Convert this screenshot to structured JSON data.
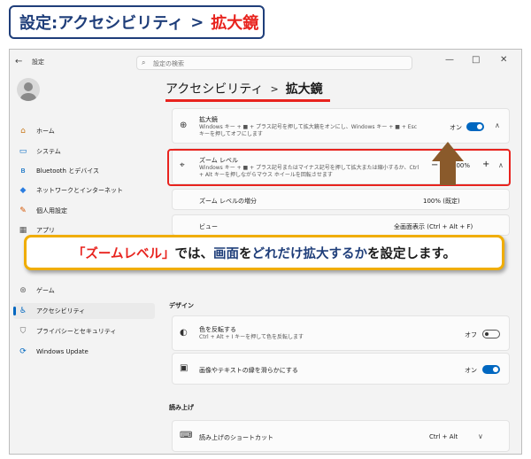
{
  "header": {
    "title_part1": "設定:アクセシビリティ",
    "title_sep": ">",
    "title_part2": "拡大鏡"
  },
  "window": {
    "app_title": "設定",
    "search_placeholder": "設定の検索",
    "controls": {
      "minimize": "—",
      "maximize": "□",
      "close": "✕"
    }
  },
  "sidebar": {
    "items": [
      {
        "label": "ホーム",
        "icon": "home-icon",
        "glyph": "⌂",
        "color": "#c97a1e"
      },
      {
        "label": "システム",
        "icon": "monitor-icon",
        "glyph": "▭",
        "color": "#0067c0"
      },
      {
        "label": "Bluetooth とデバイス",
        "icon": "bluetooth-icon",
        "glyph": "ʙ",
        "color": "#0067c0"
      },
      {
        "label": "ネットワークとインターネット",
        "icon": "wifi-icon",
        "glyph": "◆",
        "color": "#2b7de0"
      },
      {
        "label": "個人用設定",
        "icon": "brush-icon",
        "glyph": "✎",
        "color": "#d45500"
      },
      {
        "label": "アプリ",
        "icon": "apps-icon",
        "glyph": "▦",
        "color": "#555555"
      },
      {
        "label": "ゲーム",
        "icon": "gamepad-icon",
        "glyph": "⊛",
        "color": "#666666"
      },
      {
        "label": "アクセシビリティ",
        "icon": "accessibility-icon",
        "glyph": "♿",
        "color": "#0067c0"
      },
      {
        "label": "プライバシーとセキュリティ",
        "icon": "shield-icon",
        "glyph": "⛉",
        "color": "#666666"
      },
      {
        "label": "Windows Update",
        "icon": "update-icon",
        "glyph": "⟳",
        "color": "#0067c0"
      }
    ]
  },
  "breadcrumb": {
    "parent": "アクセシビリティ",
    "sep": ">",
    "current": "拡大鏡"
  },
  "magnifier": {
    "title": "拡大鏡",
    "desc": "Windows キー + ■ + プラス記号を押して拡大鏡をオンにし、Windows キー + ■ + Esc キーを押してオフにします",
    "state": "オン"
  },
  "zoom_level": {
    "title": "ズーム レベル",
    "desc": "Windows キー + ■ + プラス記号またはマイナス記号を押して拡大または縮小するか、Ctrl + Alt キーを押しながらマウス ホイールを回転させます",
    "minus": "−",
    "value": "100%",
    "plus": "+"
  },
  "zoom_increment": {
    "title": "ズーム レベルの増分",
    "value": "100% (既定)"
  },
  "view": {
    "title": "ビュー",
    "value": "全画面表示 (Ctrl + Alt + F)"
  },
  "callout": {
    "part1": "「ズームレベル」",
    "part2": "では、",
    "part3": "画面",
    "part4": "を",
    "part5": "どれだけ拡大するか",
    "part6": "を設定します。"
  },
  "design_section": {
    "label": "デザイン"
  },
  "invert_colors": {
    "title": "色を反転する",
    "desc": "Ctrl + Alt + I キーを押して色を反転します",
    "state": "オフ"
  },
  "smooth_edges": {
    "title": "画像やテキストの縁を滑らかにする",
    "state": "オン"
  },
  "reading_section": {
    "label": "読み上げ"
  },
  "reading_shortcut": {
    "title": "読み上げのショートカット",
    "value": "Ctrl + Alt"
  },
  "colors": {
    "accent": "#0067c0",
    "highlight": "#e8231e",
    "callout_border": "#f0ad00",
    "arrow": "#8a5a2b"
  }
}
